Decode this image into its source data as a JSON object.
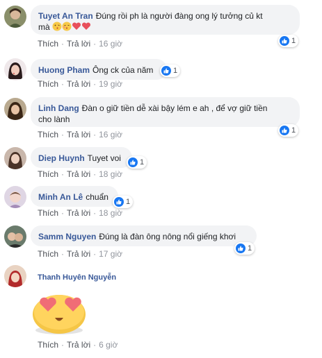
{
  "colors": {
    "name": "#385898",
    "bubble": "#f2f3f5",
    "like": "#1877f2",
    "meta": "#90949c"
  },
  "actions": {
    "like": "Thích",
    "reply": "Trả lời"
  },
  "comments": [
    {
      "author": "Tuyet An Tran",
      "text": "Đúng rồi ph là người đàng ong lý tưởng củ kt",
      "text2": "mà",
      "time": "16 giờ",
      "reactions": "1"
    },
    {
      "author": "Huong Pham",
      "text": "Ông ck của năm",
      "time": "19 giờ",
      "reactions": "1"
    },
    {
      "author": "Linh Dang",
      "text": "Đàn o giữ tiền dễ xài bậy lém e ah , để vợ giữ tiền",
      "text2": "cho lành",
      "time": "16 giờ",
      "reactions": "1"
    },
    {
      "author": "Diep Huynh",
      "text": "Tuyet voi",
      "time": "18 giờ",
      "reactions": "1"
    },
    {
      "author": "Minh An Lê",
      "text": "chuẩn",
      "time": "18 giờ",
      "reactions": "1"
    },
    {
      "author": "Samm Nguyen",
      "text": "Đúng là đàn ông nông nổi giếng khơi",
      "time": "17 giờ",
      "reactions": "1"
    },
    {
      "author": "Thanh Huyên Nguyễn",
      "text": "",
      "time": "6 giờ",
      "sticker": "heart-eyes-emoji"
    }
  ]
}
